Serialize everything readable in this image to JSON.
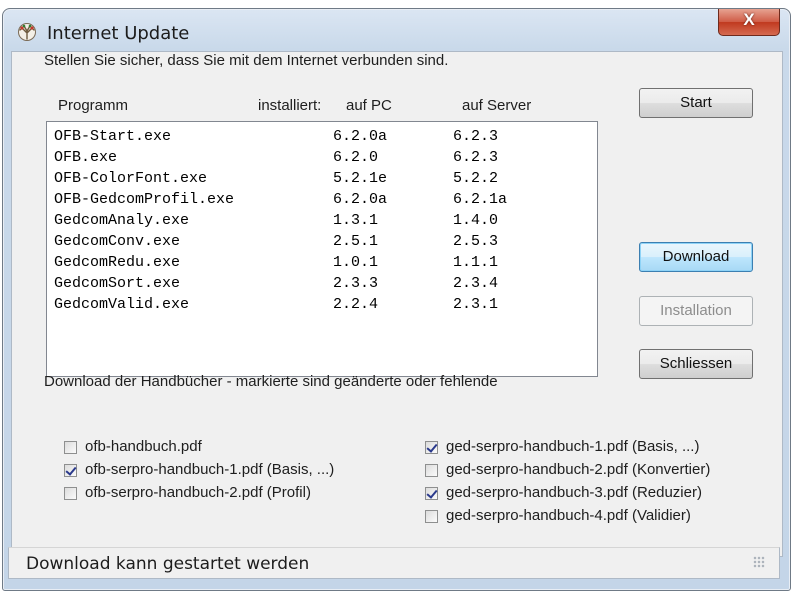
{
  "window": {
    "title": "Internet Update",
    "close_label": "X"
  },
  "instruction": "Stellen Sie sicher, dass Sie mit dem Internet verbunden sind.",
  "buttons": {
    "start": "Start",
    "download": "Download",
    "installation": "Installation",
    "schliessen": "Schliessen"
  },
  "table": {
    "headers": [
      "Programm",
      "installiert:",
      "auf PC",
      "auf Server"
    ],
    "rows": [
      [
        "OFB-Start.exe",
        "6.2.0a",
        "6.2.3"
      ],
      [
        "OFB.exe",
        "6.2.0",
        "6.2.3"
      ],
      [
        "OFB-ColorFont.exe",
        "5.2.1e",
        "5.2.2"
      ],
      [
        "OFB-GedcomProfil.exe",
        "6.2.0a",
        "6.2.1a"
      ],
      [
        "GedcomAnaly.exe",
        "1.3.1",
        "1.4.0"
      ],
      [
        "GedcomConv.exe",
        "2.5.1",
        "2.5.3"
      ],
      [
        "GedcomRedu.exe",
        "1.0.1",
        "1.1.1"
      ],
      [
        "GedcomSort.exe",
        "2.3.3",
        "2.3.4"
      ],
      [
        "GedcomValid.exe",
        "2.2.4",
        "2.3.1"
      ]
    ]
  },
  "manuals": {
    "heading": "Download der Handbücher - markierte sind geänderte oder fehlende",
    "left": [
      {
        "label": "ofb-handbuch.pdf",
        "checked": false
      },
      {
        "label": "ofb-serpro-handbuch-1.pdf (Basis, ...)",
        "checked": true
      },
      {
        "label": "ofb-serpro-handbuch-2.pdf (Profil)",
        "checked": false
      }
    ],
    "right": [
      {
        "label": "ged-serpro-handbuch-1.pdf (Basis, ...)",
        "checked": true
      },
      {
        "label": "ged-serpro-handbuch-2.pdf (Konvertier)",
        "checked": false
      },
      {
        "label": "ged-serpro-handbuch-3.pdf (Reduzier)",
        "checked": true
      },
      {
        "label": "ged-serpro-handbuch-4.pdf (Validier)",
        "checked": false
      }
    ]
  },
  "status": "Download kann gestartet werden",
  "icon": "family-tree-icon"
}
